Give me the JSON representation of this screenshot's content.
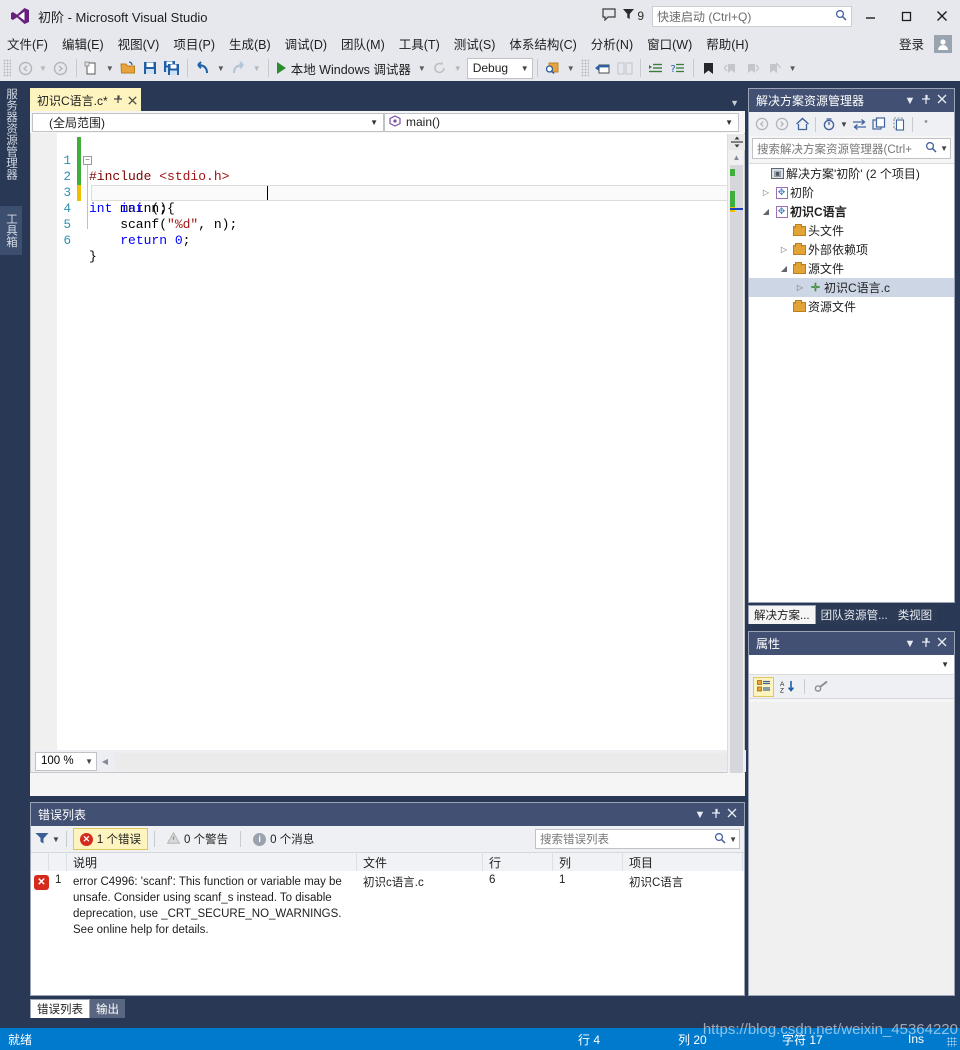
{
  "window": {
    "title": "初阶 - Microsoft Visual Studio",
    "logo_icon": "visual-studio-logo",
    "minimize": "—",
    "maximize": "▢",
    "close": "✕",
    "feedback_icon": "feedback-icon",
    "notification_icon": "notification-flag-icon",
    "notification_count": "9",
    "signin": "登录",
    "account_icon": "account-icon"
  },
  "quick_launch": {
    "placeholder": "快速启动 (Ctrl+Q)",
    "icon": "search-icon"
  },
  "menu": {
    "items": [
      {
        "label": "文件(F)"
      },
      {
        "label": "编辑(E)"
      },
      {
        "label": "视图(V)"
      },
      {
        "label": "项目(P)"
      },
      {
        "label": "生成(B)"
      },
      {
        "label": "调试(D)"
      },
      {
        "label": "团队(M)"
      },
      {
        "label": "工具(T)"
      },
      {
        "label": "测试(S)"
      },
      {
        "label": "体系结构(C)"
      },
      {
        "label": "分析(N)"
      },
      {
        "label": "窗口(W)"
      },
      {
        "label": "帮助(H)"
      }
    ]
  },
  "toolbar": {
    "nav_back_icon": "navigate-back-icon",
    "nav_forward_icon": "navigate-forward-icon",
    "new_item_icon": "new-item-icon",
    "open_icon": "open-folder-icon",
    "save_icon": "save-icon",
    "save_all_icon": "save-all-icon",
    "undo_icon": "undo-icon",
    "redo_icon": "redo-icon",
    "run_label": "本地 Windows 调试器",
    "run_icon": "play-icon",
    "restart_icon": "restart-icon",
    "config_value": "Debug",
    "find_icon": "find-in-files-icon",
    "window_icon": "new-window-icon",
    "compare_icon": "compare-icon",
    "indent_icon": "increase-indent-icon",
    "outdent_icon": "comment-icon",
    "bookmark_icon": "bookmark-icon",
    "prev_bookmark_icon": "previous-bookmark-icon",
    "next_bookmark_icon": "next-bookmark-icon",
    "clear_bookmark_icon": "clear-bookmarks-icon"
  },
  "left_dock": {
    "tabs": [
      {
        "label": "服务器资源管理器",
        "active": false
      },
      {
        "label": "工具箱",
        "active": true
      }
    ]
  },
  "editor": {
    "tab": {
      "title": "初识C语言.c*",
      "pin_icon": "pin-icon",
      "close_icon": "close-icon"
    },
    "scope_combo": "(全局范围)",
    "member_combo": "main()",
    "member_icon": "method-icon",
    "zoom": "100 %",
    "code_lines": [
      {
        "num": "1",
        "indent": 0,
        "change": "green",
        "tokens": [
          {
            "t": "#include ",
            "c": "pp"
          },
          {
            "t": "<stdio.h>",
            "c": "str"
          }
        ]
      },
      {
        "num": "2",
        "indent": 0,
        "change": "green",
        "fold": true,
        "tokens": [
          {
            "t": "int",
            "c": "kw"
          },
          {
            "t": " main(){",
            "c": "plain"
          }
        ]
      },
      {
        "num": "3",
        "indent": 1,
        "change": "green",
        "tokens": [
          {
            "t": "    ",
            "c": "plain"
          },
          {
            "t": "int",
            "c": "kw"
          },
          {
            "t": " n;",
            "c": "plain"
          }
        ]
      },
      {
        "num": "4",
        "indent": 1,
        "change": "yellow",
        "current": true,
        "tokens": [
          {
            "t": "    scanf(",
            "c": "plain"
          },
          {
            "t": "\"%d\"",
            "c": "str"
          },
          {
            "t": ", n);",
            "c": "plain"
          }
        ]
      },
      {
        "num": "5",
        "indent": 1,
        "change": "none",
        "tokens": [
          {
            "t": "    ",
            "c": "plain"
          },
          {
            "t": "return",
            "c": "kw"
          },
          {
            "t": " ",
            "c": "plain"
          },
          {
            "t": "0",
            "c": "num"
          },
          {
            "t": ";",
            "c": "plain"
          }
        ]
      },
      {
        "num": "6",
        "indent": 0,
        "change": "none",
        "tokens": [
          {
            "t": "}",
            "c": "plain"
          }
        ]
      }
    ]
  },
  "solution_explorer": {
    "title": "解决方案资源管理器",
    "dropdown_icon": "chevron-down-icon",
    "pin_icon": "pin-icon",
    "close_icon": "close-icon",
    "toolbar": {
      "back_icon": "back-icon",
      "forward_icon": "forward-icon",
      "home_icon": "home-icon",
      "pending_changes_icon": "pending-changes-icon",
      "sync_icon": "sync-with-active-document-icon",
      "refresh_icon": "refresh-icon",
      "show_all_files_icon": "show-all-files-icon",
      "overflow_icon": "overflow-chevron-icon"
    },
    "search_placeholder": "搜索解决方案资源管理器(Ctrl+",
    "search_icon": "search-icon",
    "tree": [
      {
        "label": "解决方案'初阶' (2 个项目)",
        "depth": 0,
        "twist": "",
        "icon": "solution-icon",
        "bold": false,
        "selected": false
      },
      {
        "label": "初阶",
        "depth": 1,
        "twist": "▷",
        "icon": "project-icon",
        "bold": false,
        "selected": false
      },
      {
        "label": "初识C语言",
        "depth": 1,
        "twist": "◢",
        "icon": "project-icon",
        "bold": true,
        "selected": false
      },
      {
        "label": "头文件",
        "depth": 2,
        "twist": "",
        "icon": "folder-icon",
        "bold": false,
        "selected": false
      },
      {
        "label": "外部依赖项",
        "depth": 2,
        "twist": "▷",
        "icon": "folder-icon",
        "bold": false,
        "selected": false
      },
      {
        "label": "源文件",
        "depth": 2,
        "twist": "◢",
        "icon": "folder-icon",
        "bold": false,
        "selected": false
      },
      {
        "label": "初识C语言.c",
        "depth": 3,
        "twist": "▷",
        "icon": "c-file-icon",
        "bold": false,
        "selected": true
      },
      {
        "label": "资源文件",
        "depth": 2,
        "twist": "",
        "icon": "folder-icon",
        "bold": false,
        "selected": false
      }
    ],
    "bottom_tabs": [
      {
        "label": "解决方案...",
        "active": true
      },
      {
        "label": "团队资源管...",
        "active": false
      },
      {
        "label": "类视图",
        "active": false
      }
    ]
  },
  "properties": {
    "title": "属性",
    "dropdown_icon": "chevron-down-icon",
    "pin_icon": "pin-icon",
    "close_icon": "close-icon",
    "categorized_icon": "categorized-view-icon",
    "alphabetical_icon": "alphabetical-sort-icon",
    "property_pages_icon": "property-pages-icon",
    "object_chevron_icon": "chevron-down-icon"
  },
  "error_list": {
    "title": "错误列表",
    "dropdown_icon": "chevron-down-icon",
    "pin_icon": "pin-icon",
    "close_icon": "close-icon",
    "filter_icon": "filter-icon",
    "filter_caret_icon": "chevron-down-icon",
    "chips": [
      {
        "label": "1 个错误",
        "icon": "error-icon",
        "active": true
      },
      {
        "label": "0 个警告",
        "icon": "warning-icon",
        "active": false
      },
      {
        "label": "0 个消息",
        "icon": "info-icon",
        "active": false
      }
    ],
    "search_placeholder": "搜索错误列表",
    "search_icon": "search-icon",
    "columns": [
      "",
      "",
      "说明",
      "文件",
      "行",
      "列",
      "项目"
    ],
    "rows": [
      {
        "severity_icon": "error-icon",
        "index": "1",
        "description": "error C4996: 'scanf': This function or variable may be unsafe. Consider using scanf_s instead. To disable deprecation, use _CRT_SECURE_NO_WARNINGS. See online help for details.",
        "file": "初识c语言.c",
        "line": "6",
        "column": "1",
        "project": "初识C语言"
      }
    ],
    "bottom_tabs": [
      {
        "label": "错误列表",
        "active": true
      },
      {
        "label": "输出",
        "active": false
      }
    ]
  },
  "status_bar": {
    "ready": "就绪",
    "line": "行 4",
    "column": "列 20",
    "char": "字符 17",
    "insert_mode": "Ins",
    "watermark": "https://blog.csdn.net/weixin_45364220"
  }
}
